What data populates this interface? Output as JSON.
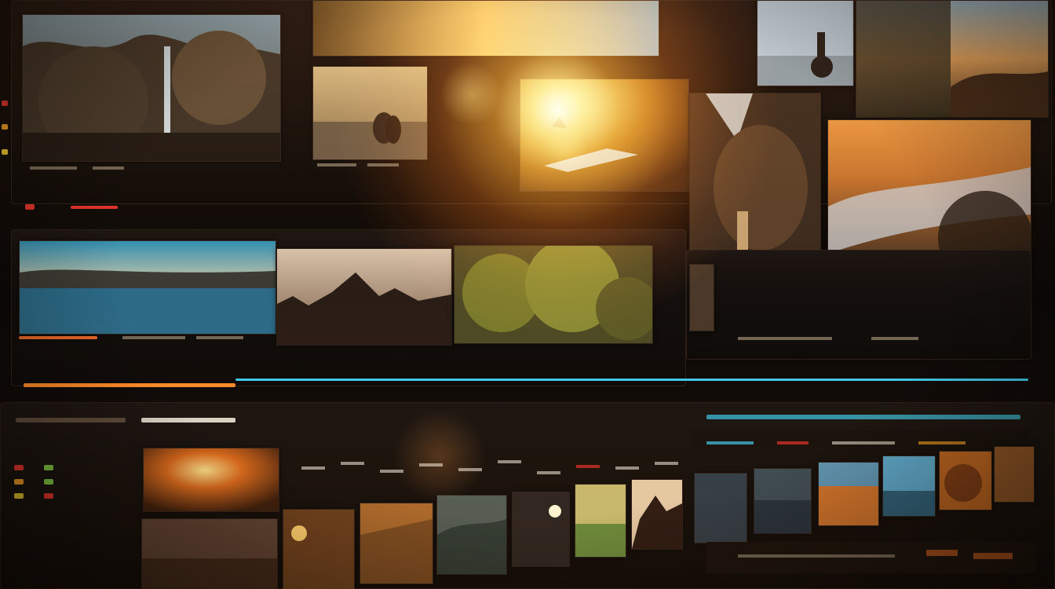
{
  "scene": {
    "description_free": true,
    "accent_orange": "#ff9a2e",
    "accent_cyan": "#3fc7e6",
    "led_colors": [
      "#e3322a",
      "#f09a22",
      "#e9c52b",
      "#7cc341"
    ]
  }
}
